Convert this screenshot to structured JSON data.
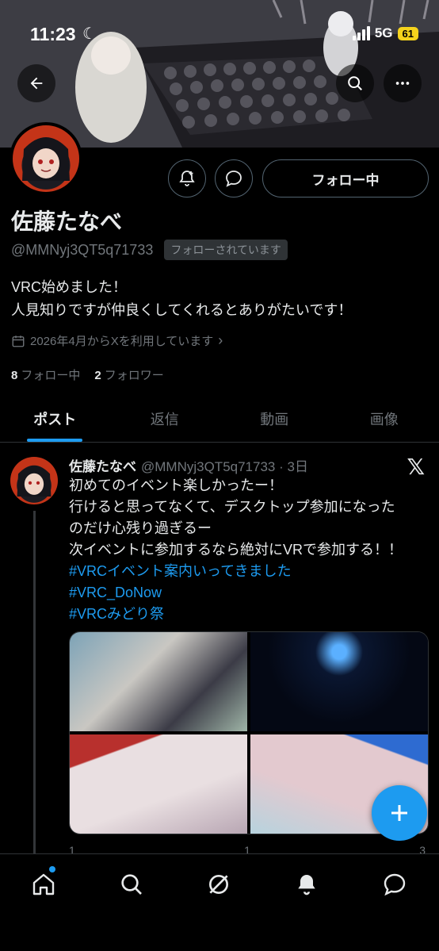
{
  "status_bar": {
    "time": "11:23",
    "network": "5G",
    "battery": "61"
  },
  "profile": {
    "name": "佐藤たなべ",
    "handle": "@MMNyj3QT5q71733",
    "follows_you_badge": "フォローされています",
    "follow_button_label": "フォロー中",
    "bio_line1": "VRC始めました！",
    "bio_line2": "人見知りですが仲良くしてくれるとありがたいです！",
    "joined": "2026年4月からXを利用しています",
    "following_count": "8",
    "following_label": "フォロー中",
    "followers_count": "2",
    "followers_label": "フォロワー"
  },
  "tabs": [
    {
      "label": "ポスト",
      "active": true
    },
    {
      "label": "返信",
      "active": false
    },
    {
      "label": "動画",
      "active": false
    },
    {
      "label": "画像",
      "active": false
    }
  ],
  "post": {
    "author": "佐藤たなべ",
    "meta": "@MMNyj3QT5q71733 · 3日",
    "line1": "初めてのイベント楽しかったー！",
    "line2": "行けると思ってなくて、デスクトップ参加になった",
    "line3": "のだけ心残り過ぎるー",
    "line4": "次イベントに参加するなら絶対にVRで参加する！！",
    "hashtag1": "#VRCイベント案内いってきました",
    "hashtag2": "#VRC_DoNow",
    "hashtag3": "#VRCみどり祭",
    "reply_count": "1",
    "like_count": "1",
    "views_count": "3"
  },
  "colors": {
    "accent": "#1d9bf0",
    "background": "#000000",
    "muted": "#71767b"
  }
}
